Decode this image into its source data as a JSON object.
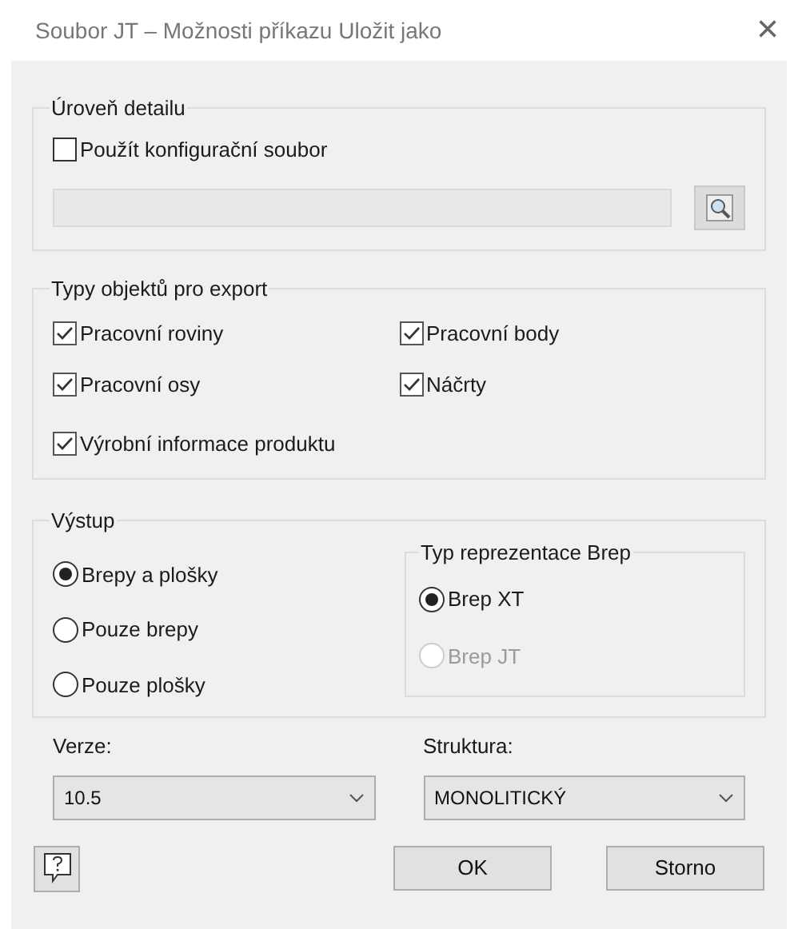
{
  "window": {
    "title": "Soubor JT – Možnosti příkazu Uložit jako",
    "close": "×"
  },
  "detail": {
    "title": "Úroveň detailu",
    "use_config": {
      "label": "Použít konfigurační soubor",
      "checked": false
    },
    "path_field": {
      "disabled": true
    }
  },
  "export_types": {
    "title": "Typy objektů pro export",
    "items": [
      {
        "label": "Pracovní roviny",
        "checked": true
      },
      {
        "label": "Pracovní body",
        "checked": true
      },
      {
        "label": "Pracovní osy",
        "checked": true
      },
      {
        "label": "Náčrty",
        "checked": true
      },
      {
        "label": "Výrobní informace produktu",
        "checked": true
      }
    ]
  },
  "output": {
    "title": "Výstup",
    "options": [
      {
        "label": "Brepy a plošky",
        "selected": true
      },
      {
        "label": "Pouze brepy",
        "selected": false
      },
      {
        "label": "Pouze plošky",
        "selected": false
      }
    ],
    "brep": {
      "title": "Typ reprezentace Brep",
      "options": [
        {
          "label": "Brep XT",
          "selected": true,
          "disabled": false
        },
        {
          "label": "Brep JT",
          "selected": false,
          "disabled": true
        }
      ]
    }
  },
  "version": {
    "label": "Verze:",
    "value": "10.5"
  },
  "structure": {
    "label": "Struktura:",
    "value": "MONOLITICKÝ"
  },
  "buttons": [
    "OK",
    "Storno"
  ]
}
